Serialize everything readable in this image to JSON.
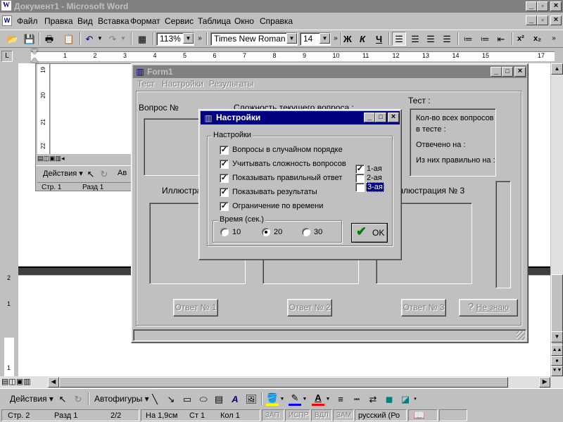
{
  "word": {
    "title": "Документ1 - Microsoft Word",
    "menu": [
      "Файл",
      "Правка",
      "Вид",
      "Вставка",
      "Формат",
      "Сервис",
      "Таблица",
      "Окно",
      "Справка"
    ],
    "zoom": "113%",
    "font": "Times New Roman",
    "font_size": "14",
    "bold": "Ж",
    "italic": "К",
    "underline": "Ч",
    "ruler_numbers": [
      "1",
      "2",
      "3",
      "4",
      "5",
      "6",
      "7",
      "8",
      "9",
      "10",
      "11",
      "12",
      "13",
      "14",
      "15",
      "17"
    ],
    "vruler_numbers": [
      "19",
      "20",
      "21",
      "22"
    ],
    "vruler_bottom": [
      "2",
      "1",
      "1"
    ],
    "draw_actions": "Действия",
    "autoshapes": "Автофигуры",
    "inner_actions": "Действия",
    "inner_av": "Ав",
    "inner_status": {
      "page": "Стр. 1",
      "section": "Разд 1"
    },
    "status": {
      "page": "Стр. 2",
      "section": "Разд 1",
      "pages": "2/2",
      "at": "На 1,9см",
      "line": "Ст 1",
      "col": "Кол 1",
      "rec": "ЗАП",
      "trk": "ИСПР",
      "ext": "ВДЛ",
      "ovr": "ЗАМ",
      "lang": "русский (Ро"
    }
  },
  "form1": {
    "title": "Form1",
    "menu": [
      "Тест",
      "Настройки",
      "Результаты"
    ],
    "question_label": "Вопрос №",
    "difficulty_label": "Сложность текущего вопроса :",
    "test_label": "Тест :",
    "info": [
      "Кол-во всех вопросов",
      "в тесте :",
      "Отвечено на :",
      "Из них правильно на :"
    ],
    "illus_left": "Иллюстра",
    "illus_right": "ллюстрация № 3",
    "answers": [
      "Ответ № 1",
      "Ответ № 2",
      "Ответ № 3"
    ],
    "dont_know": "Не знаю"
  },
  "settings": {
    "title": "Настройки",
    "group": "Настройки",
    "options": [
      {
        "label": "Вопросы в случайном порядке",
        "checked": true
      },
      {
        "label": "Учитывать сложность вопросов",
        "checked": true
      },
      {
        "label": "Показывать правильный ответ",
        "checked": true
      },
      {
        "label": "Показывать результаты",
        "checked": true
      },
      {
        "label": "Ограничение по времени",
        "checked": true
      }
    ],
    "levels": [
      {
        "label": "1-ая",
        "checked": true
      },
      {
        "label": "2-ая",
        "checked": false
      },
      {
        "label": "3-ая",
        "checked": false
      }
    ],
    "time_group": "Время (сек.)",
    "times": [
      {
        "label": "10",
        "selected": false
      },
      {
        "label": "20",
        "selected": true
      },
      {
        "label": "30",
        "selected": false
      }
    ],
    "ok": "OK"
  },
  "colors": {
    "titlebar_active": "#000080",
    "titlebar_inactive": "#808080",
    "ok_check": "#008000"
  }
}
